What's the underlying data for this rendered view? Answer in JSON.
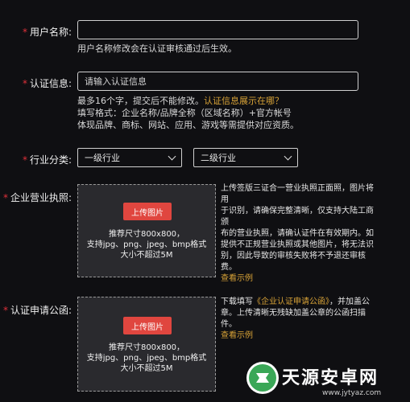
{
  "username": {
    "label": "用户名称:",
    "value": "",
    "hint": "用户名称修改会在认证审核通过后生效。"
  },
  "cert_info": {
    "label": "认证信息:",
    "placeholder": "请输入认证信息",
    "hint_line1": "最多16个字，提交后不能修改。",
    "hint_link": "认证信息展示在哪？",
    "hint_line2": "填写格式：企业名称/品牌全称（区域名称）+官方帐号",
    "hint_line3": "体现品牌、商标、网站、应用、游戏等需提供对应资质。"
  },
  "industry": {
    "label": "行业分类:",
    "primary": "一级行业",
    "secondary": "二级行业"
  },
  "license": {
    "label": "企业营业执照:",
    "upload_button": "上传图片",
    "req_line1": "推荐尺寸800x800，",
    "req_line2": "支持jpg、png、jpeg、bmp格式",
    "req_line3": "大小不超过5M",
    "side_line1": "上传签版三证合一营业执照正面照，图片将用",
    "side_line2": "于识别，请确保完整清晰，仅支持大陆工商颁",
    "side_line3": "布的营业执照，请确认证件在有效期内。如",
    "side_line4": "提供不正规营业执照或其他图片，将无法识",
    "side_line5": "别，因此导致的审核失败将不予退还审核费。",
    "example_link": "查看示例"
  },
  "letter": {
    "label": "认证申请公函:",
    "upload_button": "上传图片",
    "req_line1": "推荐尺寸800x800，",
    "req_line2": "支持jpg、png、jpeg、bmp格式",
    "req_line3": "大小不超过5M",
    "side_prefix": "下载填写",
    "side_link": "《企业认证申请公函》",
    "side_suffix": "，并加盖公",
    "side_line2": "章。上传清晰无残缺加盖公章的公函扫描件。",
    "example_link": "查看示例"
  },
  "watermark": {
    "name": "天源安卓网",
    "url": "www.jytyaz.com"
  }
}
